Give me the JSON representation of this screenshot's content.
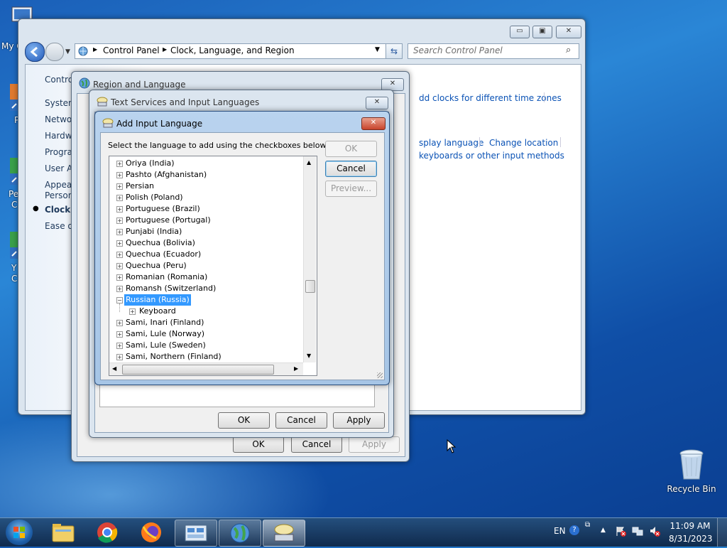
{
  "desktop": {
    "icons": [
      {
        "label": "Recycle Bin"
      }
    ],
    "partial_labels": [
      "My C",
      "P",
      "Pe",
      "C",
      "Y",
      "C"
    ]
  },
  "control_panel": {
    "breadcrumb": [
      "Control Panel",
      "Clock, Language, and Region"
    ],
    "search_placeholder": "Search Control Panel",
    "sidebar": [
      {
        "label": "Control"
      },
      {
        "label": "System"
      },
      {
        "label": "Netwo"
      },
      {
        "label": "Hardwa"
      },
      {
        "label": "Progra"
      },
      {
        "label": "User Ac"
      },
      {
        "label": "Appear"
      },
      {
        "label": "Persona"
      },
      {
        "label": "Clock, l"
      },
      {
        "label": "Ease of"
      }
    ],
    "links": {
      "time_zones": "dd clocks for different time zones",
      "display_language": "splay language",
      "change_location": "Change location",
      "keyboards": "keyboards or other input methods"
    }
  },
  "region_dialog": {
    "title": "Region and Language",
    "ok": "OK",
    "cancel": "Cancel",
    "apply": "Apply"
  },
  "text_services_dialog": {
    "title": "Text Services and Input Languages",
    "ok": "OK",
    "cancel": "Cancel",
    "apply": "Apply"
  },
  "add_input_dialog": {
    "title": "Add Input Language",
    "instruction": "Select the language to add using the checkboxes below.",
    "ok": "OK",
    "cancel": "Cancel",
    "preview": "Preview...",
    "tree_items": [
      {
        "label": "Oriya (India)"
      },
      {
        "label": "Pashto (Afghanistan)"
      },
      {
        "label": "Persian"
      },
      {
        "label": "Polish (Poland)"
      },
      {
        "label": "Portuguese (Brazil)"
      },
      {
        "label": "Portuguese (Portugal)"
      },
      {
        "label": "Punjabi (India)"
      },
      {
        "label": "Quechua (Bolivia)"
      },
      {
        "label": "Quechua (Ecuador)"
      },
      {
        "label": "Quechua (Peru)"
      },
      {
        "label": "Romanian (Romania)"
      },
      {
        "label": "Romansh (Switzerland)"
      },
      {
        "label": "Russian (Russia)",
        "selected": true,
        "expanded": true
      },
      {
        "label": "Keyboard",
        "child": true
      },
      {
        "label": "Sami, Inari (Finland)"
      },
      {
        "label": "Sami, Lule (Norway)"
      },
      {
        "label": "Sami, Lule (Sweden)"
      },
      {
        "label": "Sami, Northern (Finland)"
      }
    ]
  },
  "taskbar": {
    "language": "EN",
    "time": "11:09 AM",
    "date": "8/31/2023"
  }
}
